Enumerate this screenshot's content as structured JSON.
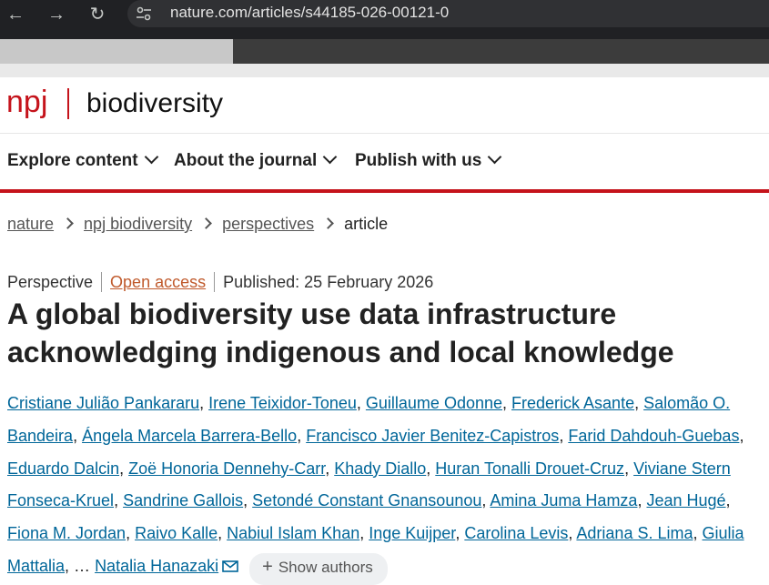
{
  "browser": {
    "url": "nature.com/articles/s44185-026-00121-0",
    "back_icon": "←",
    "forward_icon": "→",
    "reload_icon": "↻"
  },
  "journal": {
    "logo_prefix": "npj",
    "logo_name": "biodiversity",
    "brand_color": "#c5131b"
  },
  "nav": {
    "items": [
      {
        "label": "Explore content"
      },
      {
        "label": "About the journal"
      },
      {
        "label": "Publish with us"
      }
    ]
  },
  "breadcrumb": {
    "items": [
      "nature",
      "npj biodiversity",
      "perspectives"
    ],
    "current": "article"
  },
  "article": {
    "type": "Perspective",
    "access": "Open access",
    "published": "Published: 25 February 2026",
    "title": "A global biodiversity use data infrastructure acknowledging indigenous and local knowledge",
    "authors": [
      "Cristiane Julião Pankararu",
      "Irene Teixidor-Toneu",
      "Guillaume Odonne",
      "Frederick Asante",
      "Salomão O. Bandeira",
      "Ángela Marcela Barrera-Bello",
      "Francisco Javier Benitez-Capistros",
      "Farid Dahdouh-Guebas",
      "Eduardo Dalcin",
      "Zoë Honoria Dennehy-Carr",
      "Khady Diallo",
      "Huran Tonalli Drouet-Cruz",
      "Viviane Stern Fonseca-Kruel",
      "Sandrine Gallois",
      "Setondé Constant Gnansounou",
      "Amina Juma Hamza",
      "Jean Hugé",
      "Fiona M. Jordan",
      "Raivo Kalle",
      "Nabiul Islam Khan",
      "Inge Kuijper",
      "Carolina Levis",
      "Adriana S. Lima",
      "Giulia Mattalia"
    ],
    "ellipsis": "…",
    "last_author": "Natalia Hanazaki",
    "show_authors_label": "Show authors"
  }
}
